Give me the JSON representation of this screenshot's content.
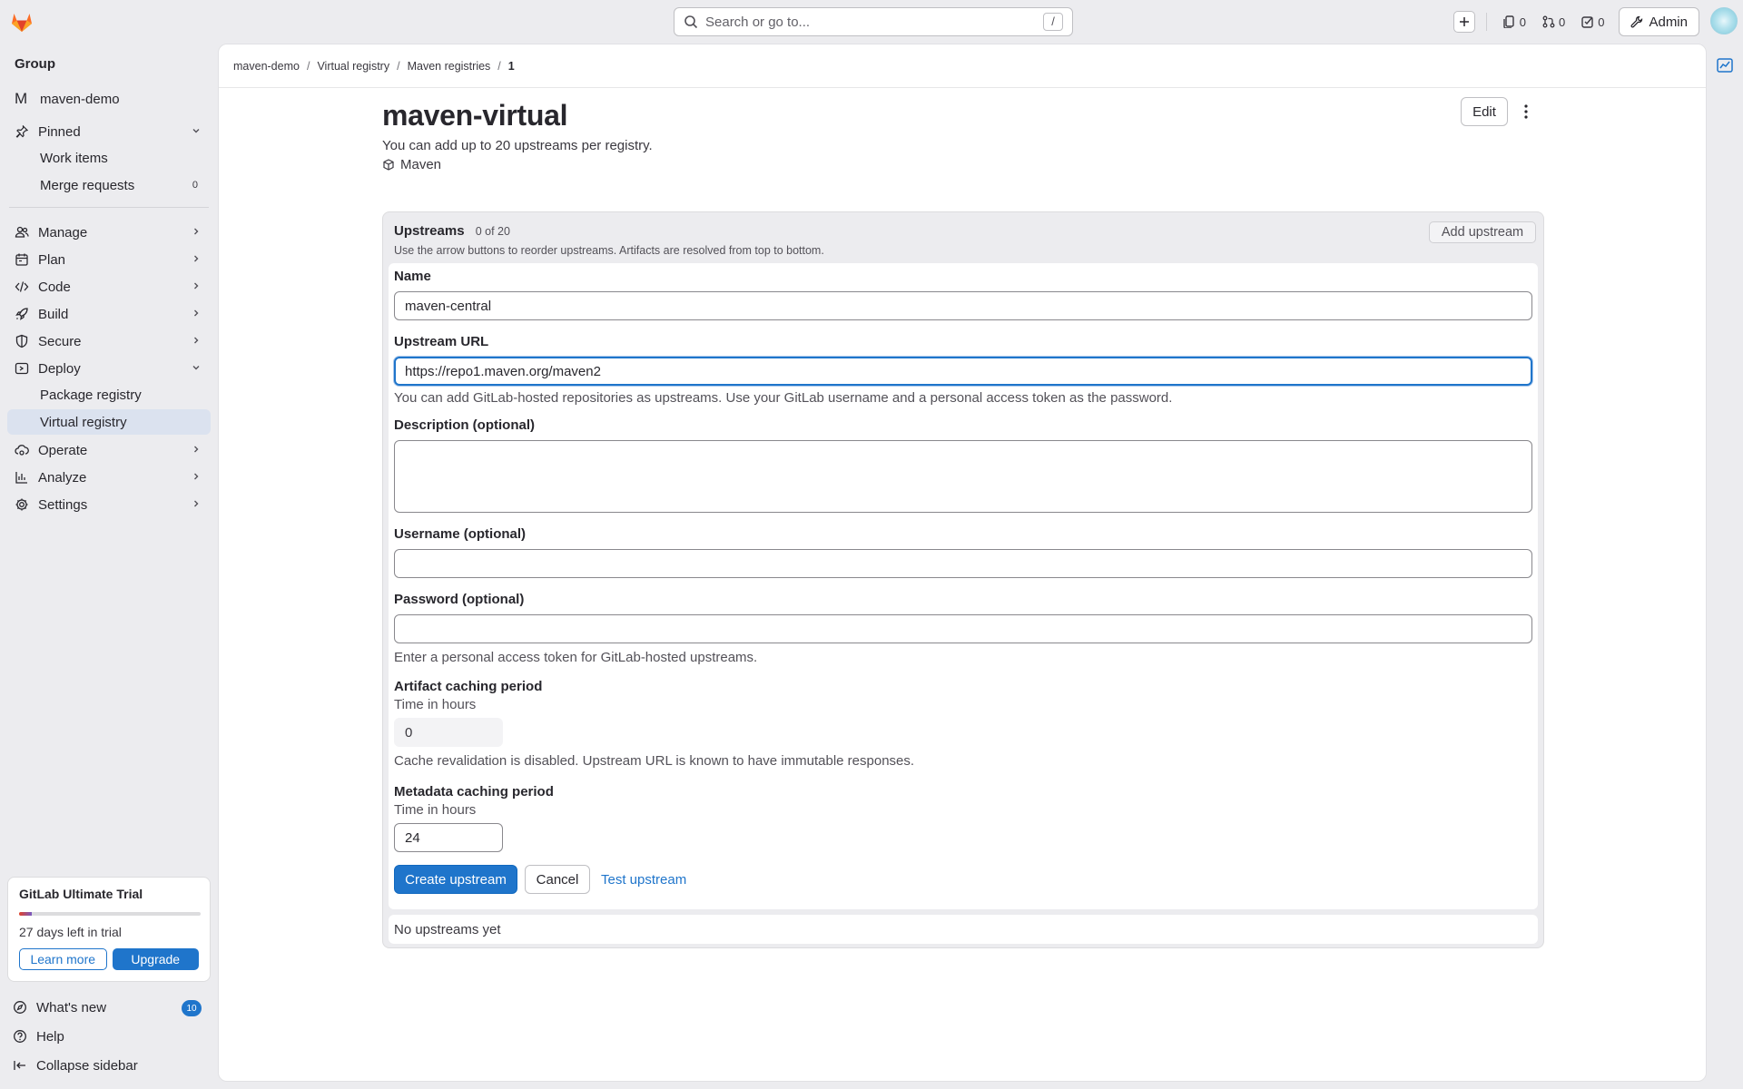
{
  "topbar": {
    "search_placeholder": "Search or go to...",
    "search_shortcut": "/",
    "issues_count": "0",
    "mr_count": "0",
    "todos_count": "0",
    "admin_label": "Admin"
  },
  "sidebar": {
    "context_label": "Group",
    "project_initial": "M",
    "project_name": "maven-demo",
    "pinned": {
      "label": "Pinned",
      "items": [
        {
          "label": "Work items",
          "count": ""
        },
        {
          "label": "Merge requests",
          "count": "0"
        }
      ]
    },
    "items": [
      {
        "label": "Manage",
        "icon": "users-icon"
      },
      {
        "label": "Plan",
        "icon": "calendar-icon"
      },
      {
        "label": "Code",
        "icon": "code-icon"
      },
      {
        "label": "Build",
        "icon": "rocket-icon"
      },
      {
        "label": "Secure",
        "icon": "shield-icon"
      },
      {
        "label": "Deploy",
        "icon": "deploy-icon"
      },
      {
        "label": "Operate",
        "icon": "cloud-gear-icon"
      },
      {
        "label": "Analyze",
        "icon": "chart-icon"
      },
      {
        "label": "Settings",
        "icon": "gear-icon"
      }
    ],
    "deploy_children": [
      {
        "label": "Package registry"
      },
      {
        "label": "Virtual registry"
      }
    ],
    "trial": {
      "title": "GitLab Ultimate Trial",
      "progress_fraction": 0.07,
      "days_left": "27 days left in trial",
      "learn_more": "Learn more",
      "upgrade": "Upgrade"
    },
    "footer": {
      "whats_new": "What's new",
      "whats_new_count": "10",
      "help": "Help",
      "collapse": "Collapse sidebar"
    }
  },
  "breadcrumb": [
    "maven-demo",
    "Virtual registry",
    "Maven registries",
    "1"
  ],
  "page": {
    "title": "maven-virtual",
    "edit_label": "Edit",
    "subtitle": "You can add up to 20 upstreams per registry.",
    "package_type": "Maven"
  },
  "upstreams": {
    "title": "Upstreams",
    "count": "0 of 20",
    "description": "Use the arrow buttons to reorder upstreams. Artifacts are resolved from top to bottom.",
    "add_button": "Add upstream",
    "empty_text": "No upstreams yet"
  },
  "form": {
    "name_label": "Name",
    "name_value": "maven-central",
    "url_label": "Upstream URL",
    "url_value": "https://repo1.maven.org/maven2",
    "url_help": "You can add GitLab-hosted repositories as upstreams. Use your GitLab username and a personal access token as the password.",
    "description_label": "Description (optional)",
    "description_value": "",
    "username_label": "Username (optional)",
    "username_value": "",
    "password_label": "Password (optional)",
    "password_value": "",
    "password_help": "Enter a personal access token for GitLab-hosted upstreams.",
    "artifact_label": "Artifact caching period",
    "artifact_sub": "Time in hours",
    "artifact_value": "0",
    "artifact_help": "Cache revalidation is disabled. Upstream URL is known to have immutable responses.",
    "metadata_label": "Metadata caching period",
    "metadata_sub": "Time in hours",
    "metadata_value": "24",
    "create_button": "Create upstream",
    "cancel_button": "Cancel",
    "test_button": "Test upstream"
  },
  "colors": {
    "accent": "#1f75cb",
    "background": "#ececef",
    "active_nav": "#dbe2ef",
    "logo": "#e24329"
  }
}
